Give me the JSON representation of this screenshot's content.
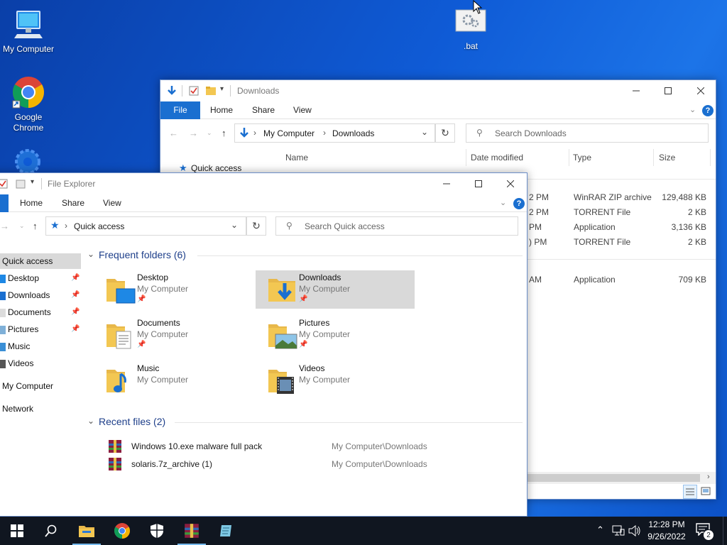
{
  "desktop": {
    "icons": [
      {
        "label": "My Computer"
      },
      {
        "label": "Google Chrome"
      },
      {
        "label": ".bat"
      }
    ]
  },
  "downloads_window": {
    "title": "Downloads",
    "tabs": {
      "file": "File",
      "home": "Home",
      "share": "Share",
      "view": "View"
    },
    "breadcrumb": {
      "root": "My Computer",
      "current": "Downloads"
    },
    "search_placeholder": "Search Downloads",
    "columns": {
      "name": "Name",
      "date": "Date modified",
      "type": "Type",
      "size": "Size"
    },
    "nav_quick_access": "Quick access",
    "rows": [
      {
        "date": "2 PM",
        "type": "WinRAR ZIP archive",
        "size": "129,488 KB"
      },
      {
        "date": "2 PM",
        "type": "TORRENT File",
        "size": "2 KB"
      },
      {
        "date": "PM",
        "type": "Application",
        "size": "3,136 KB"
      },
      {
        "date": ") PM",
        "type": "TORRENT File",
        "size": "2 KB"
      },
      {
        "date": "AM",
        "type": "Application",
        "size": "709 KB"
      }
    ]
  },
  "explorer_window": {
    "title": "File Explorer",
    "tabs": {
      "home": "Home",
      "share": "Share",
      "view": "View"
    },
    "breadcrumb": {
      "current": "Quick access"
    },
    "search_placeholder": "Search Quick access",
    "nav": [
      {
        "label": "Quick access"
      },
      {
        "label": "Desktop"
      },
      {
        "label": "Downloads"
      },
      {
        "label": "Documents"
      },
      {
        "label": "Pictures"
      },
      {
        "label": "Music"
      },
      {
        "label": "Videos"
      },
      {
        "label": "My Computer"
      },
      {
        "label": "Network"
      }
    ],
    "frequent_header": "Frequent folders (6)",
    "folders": [
      {
        "name": "Desktop",
        "location": "My Computer"
      },
      {
        "name": "Downloads",
        "location": "My Computer"
      },
      {
        "name": "Documents",
        "location": "My Computer"
      },
      {
        "name": "Pictures",
        "location": "My Computer"
      },
      {
        "name": "Music",
        "location": "My Computer"
      },
      {
        "name": "Videos",
        "location": "My Computer"
      }
    ],
    "recent_header": "Recent files (2)",
    "recent": [
      {
        "name": "Windows 10.exe malware full pack",
        "path": "My Computer\\Downloads"
      },
      {
        "name": "solaris.7z_archive (1)",
        "path": "My Computer\\Downloads"
      }
    ]
  },
  "taskbar": {
    "time": "12:28 PM",
    "date": "9/26/2022",
    "notification_count": "2"
  },
  "colors": {
    "accent": "#1a6fd0",
    "folder": "#f3c752",
    "desktop": "#0f5bd6",
    "taskbar": "#101620"
  }
}
